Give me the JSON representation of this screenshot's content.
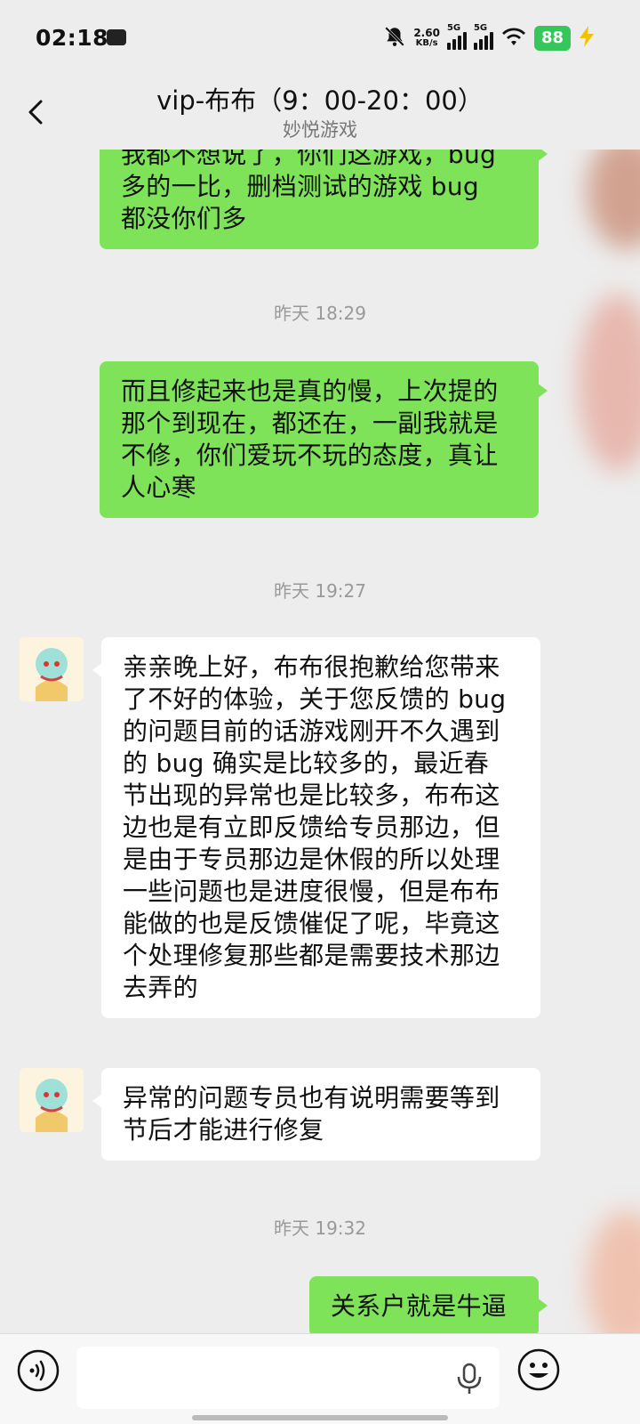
{
  "status_bar": {
    "time": "02:18",
    "net_speed_value": "2.60",
    "net_speed_unit": "KB/s",
    "sim1_label": "5G",
    "sim2_label": "5G",
    "battery": "88",
    "battery_color": "#35c759"
  },
  "header": {
    "title": "vip-布布（9：00-20：00）",
    "subtitle": "妙悦游戏"
  },
  "messages": [
    {
      "from": "me",
      "lines": [
        "我都不想说了，你们这游戏，bug",
        "多的一比，删档测试的游戏 bug",
        "都没你们多"
      ]
    },
    {
      "type": "timestamp",
      "text": "昨天 18:29"
    },
    {
      "from": "me",
      "lines": [
        "而且修起来也是真的慢，上次提的",
        "那个到现在，都还在，一副我就是",
        "不修，你们爱玩不玩的态度，真让",
        "人心寒"
      ]
    },
    {
      "type": "timestamp",
      "text": "昨天 19:27"
    },
    {
      "from": "them",
      "lines": [
        "亲亲晚上好，布布很抱歉给您带来",
        "了不好的体验，关于您反馈的 bug",
        "的问题目前的话游戏刚开不久遇到",
        "的 bug 确实是比较多的，最近春",
        "节出现的异常也是比较多，布布这",
        "边也是有立即反馈给专员那边，但",
        "是由于专员那边是休假的所以处理",
        "一些问题也是进度很慢，但是布布",
        "能做的也是反馈催促了呢，毕竟这",
        "个处理修复那些都是需要技术那边",
        "去弄的"
      ]
    },
    {
      "from": "them",
      "lines": [
        "异常的问题专员也有说明需要等到",
        "节后才能进行修复"
      ]
    },
    {
      "type": "timestamp",
      "text": "昨天 19:32"
    },
    {
      "from": "me",
      "lines": [
        "关系户就是牛逼"
      ]
    }
  ],
  "input": {
    "placeholder": "",
    "value": ""
  },
  "icons": {
    "back": "chevron-left-icon",
    "voice": "voice-input-icon",
    "mic": "microphone-icon",
    "emoji": "emoji-icon"
  },
  "colors": {
    "my_bubble": "#7fe35a",
    "their_bubble": "#ffffff",
    "background": "#ededed"
  }
}
